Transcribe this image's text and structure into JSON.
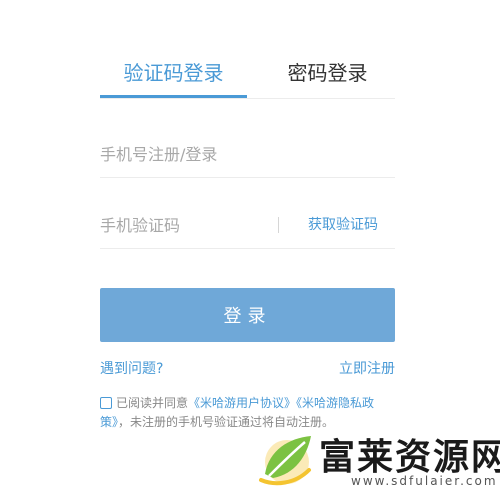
{
  "tabs": {
    "sms_login": "验证码登录",
    "password_login": "密码登录"
  },
  "phone_field": {
    "placeholder": "手机号注册/登录",
    "value": ""
  },
  "code_field": {
    "placeholder": "手机验证码",
    "value": "",
    "get_code_label": "获取验证码"
  },
  "login_button": {
    "label": "登录"
  },
  "links": {
    "help": "遇到问题?",
    "register": "立即注册"
  },
  "agreement": {
    "prefix": "已阅读并同意",
    "user_agreement": "《米哈游用户协议》",
    "privacy_policy": "《米哈游隐私政策》",
    "suffix": "，未注册的手机号验证通过将自动注册。"
  },
  "watermark": {
    "title": "富莱资源网",
    "url": "www.sdfulaier.com"
  },
  "colors": {
    "accent": "#4a9ad6",
    "button": "#6fa8d8",
    "muted_text": "#888888",
    "placeholder": "#a8a8a8"
  }
}
